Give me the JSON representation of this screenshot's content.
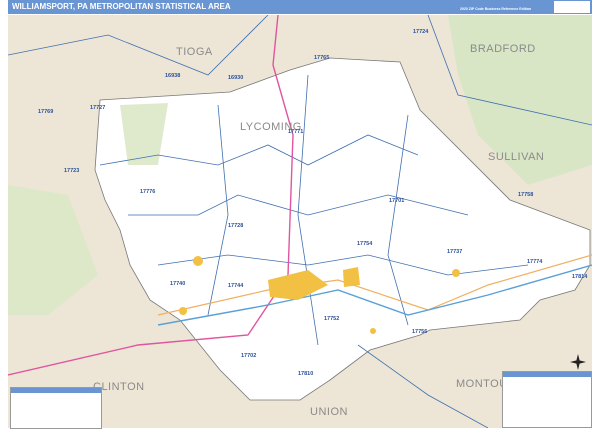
{
  "header": {
    "title": "WILLIAMSPORT, PA METROPOLITAN STATISTICAL AREA",
    "subtitle": "2020 ZIP Code Business Reference Edition"
  },
  "counties": [
    "TIOGA",
    "BRADFORD",
    "LYCOMING",
    "SULLIVAN",
    "CLINTON",
    "UNION",
    "MONTOUR"
  ],
  "zips": [
    "17724",
    "16938",
    "16930",
    "17765",
    "17769",
    "17727",
    "17771",
    "17723",
    "17776",
    "17701",
    "17758",
    "17728",
    "17754",
    "17737",
    "17774",
    "17814",
    "17740",
    "17744",
    "17752",
    "17756",
    "17702",
    "17810"
  ],
  "colors": {
    "header": "#6a95d3",
    "land": "#ede6d6",
    "county_fill": "#ffffff",
    "zip_boundary": "#3f6fb0",
    "interstate": "#e0559f",
    "highway": "#f0b060",
    "urban": "#f2c043",
    "forest": "#c9dcb0"
  }
}
